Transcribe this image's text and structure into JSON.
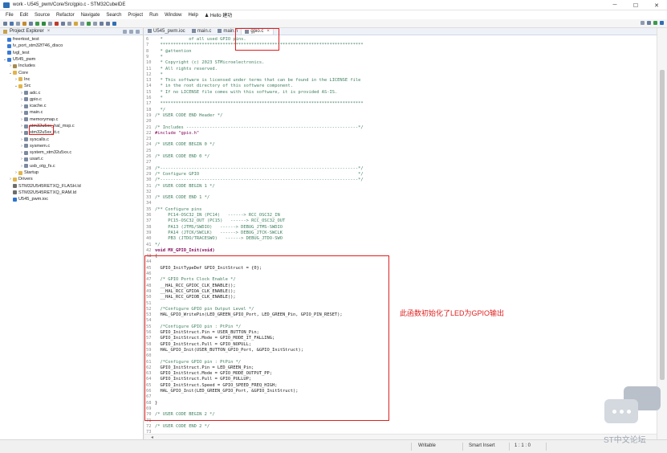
{
  "window": {
    "title": "work - U545_pwm/Core/Src/gpio.c - STM32CubeIDE",
    "minimize": "─",
    "maximize": "☐",
    "close": "✕"
  },
  "menu": [
    "File",
    "Edit",
    "Source",
    "Refactor",
    "Navigate",
    "Search",
    "Project",
    "Run",
    "Window",
    "Help",
    "♟ Hello 建功"
  ],
  "explorer": {
    "tab_label": "Project Explorer",
    "tab_close": "×",
    "tree": [
      {
        "label": "freertost_test",
        "indent": 0,
        "arrow": "",
        "icon": "proj"
      },
      {
        "label": "lv_port_stm32f746_disco",
        "indent": 0,
        "arrow": "",
        "icon": "proj"
      },
      {
        "label": "lvgl_test",
        "indent": 0,
        "arrow": "",
        "icon": "proj"
      },
      {
        "label": "U545_pwm",
        "indent": 0,
        "arrow": "⌄",
        "icon": "proj"
      },
      {
        "label": "Includes",
        "indent": 1,
        "arrow": "›",
        "icon": "inc"
      },
      {
        "label": "Core",
        "indent": 1,
        "arrow": "⌄",
        "icon": "folder"
      },
      {
        "label": "Inc",
        "indent": 2,
        "arrow": "›",
        "icon": "folder"
      },
      {
        "label": "Src",
        "indent": 2,
        "arrow": "⌄",
        "icon": "folder"
      },
      {
        "label": "adc.c",
        "indent": 3,
        "arrow": "›",
        "icon": "c"
      },
      {
        "label": "gpio.c",
        "indent": 3,
        "arrow": "›",
        "icon": "c"
      },
      {
        "label": "icache.c",
        "indent": 3,
        "arrow": "›",
        "icon": "c"
      },
      {
        "label": "main.c",
        "indent": 3,
        "arrow": "›",
        "icon": "c"
      },
      {
        "label": "memorymap.c",
        "indent": 3,
        "arrow": "›",
        "icon": "c"
      },
      {
        "label": "stm32u5xx_hal_msp.c",
        "indent": 3,
        "arrow": "›",
        "icon": "c"
      },
      {
        "label": "stm32u5xx_it.c",
        "indent": 3,
        "arrow": "›",
        "icon": "c"
      },
      {
        "label": "syscalls.c",
        "indent": 3,
        "arrow": "›",
        "icon": "c"
      },
      {
        "label": "sysmem.c",
        "indent": 3,
        "arrow": "›",
        "icon": "c"
      },
      {
        "label": "system_stm32u5xx.c",
        "indent": 3,
        "arrow": "›",
        "icon": "c"
      },
      {
        "label": "usart.c",
        "indent": 3,
        "arrow": "›",
        "icon": "c"
      },
      {
        "label": "usb_otg_fs.c",
        "indent": 3,
        "arrow": "›",
        "icon": "c"
      },
      {
        "label": "Startup",
        "indent": 2,
        "arrow": "›",
        "icon": "folder"
      },
      {
        "label": "Drivers",
        "indent": 1,
        "arrow": "›",
        "icon": "folder"
      },
      {
        "label": "STM32U545RETXQ_FLASH.ld",
        "indent": 1,
        "arrow": "",
        "icon": "ld"
      },
      {
        "label": "STM32U545RETXQ_RAM.ld",
        "indent": 1,
        "arrow": "",
        "icon": "ld"
      },
      {
        "label": "U545_pwm.ioc",
        "indent": 1,
        "arrow": "",
        "icon": "ioc"
      }
    ]
  },
  "editor": {
    "tabs": [
      {
        "label": "U545_pwm.ioc",
        "active": false
      },
      {
        "label": "main.c",
        "active": false
      },
      {
        "label": "main.h",
        "active": false
      },
      {
        "label": "gpio.c",
        "active": true
      }
    ],
    "tab_close": "×",
    "lines": [
      {
        "n": "6",
        "t": "  *          of all used GPIO pins.",
        "k": "cm"
      },
      {
        "n": "7",
        "t": "  ******************************************************************************",
        "k": "cm"
      },
      {
        "n": "8",
        "t": "  * @attention",
        "k": "cm"
      },
      {
        "n": "9",
        "t": "  *",
        "k": "cm"
      },
      {
        "n": "10",
        "t": "  * Copyright (c) 2023 STMicroelectronics.",
        "k": "cm"
      },
      {
        "n": "11",
        "t": "  * All rights reserved.",
        "k": "cm"
      },
      {
        "n": "12",
        "t": "  *",
        "k": "cm"
      },
      {
        "n": "13",
        "t": "  * This software is licensed under terms that can be found in the LICENSE file",
        "k": "cm"
      },
      {
        "n": "14",
        "t": "  * in the root directory of this software component.",
        "k": "cm"
      },
      {
        "n": "15",
        "t": "  * If no LICENSE file comes with this software, it is provided AS-IS.",
        "k": "cm"
      },
      {
        "n": "16",
        "t": "  *",
        "k": "cm"
      },
      {
        "n": "17",
        "t": "  ******************************************************************************",
        "k": "cm"
      },
      {
        "n": "18",
        "t": "  */",
        "k": "cm"
      },
      {
        "n": "19",
        "t": "/* USER CODE END Header */",
        "k": "cm"
      },
      {
        "n": "20",
        "t": "",
        "k": "cm"
      },
      {
        "n": "21",
        "t": "/* Includes ------------------------------------------------------------------*/",
        "k": "cm"
      },
      {
        "n": "22",
        "t": "#include \"gpio.h\"",
        "k": "pp"
      },
      {
        "n": "23",
        "t": "",
        "k": "cm"
      },
      {
        "n": "24",
        "t": "/* USER CODE BEGIN 0 */",
        "k": "cm"
      },
      {
        "n": "25",
        "t": "",
        "k": "cm"
      },
      {
        "n": "26",
        "t": "/* USER CODE END 0 */",
        "k": "cm"
      },
      {
        "n": "27",
        "t": "",
        "k": "cm"
      },
      {
        "n": "28",
        "t": "/*----------------------------------------------------------------------------*/",
        "k": "cm"
      },
      {
        "n": "29",
        "t": "/* Configure GPIO                                                             */",
        "k": "cm"
      },
      {
        "n": "30",
        "t": "/*----------------------------------------------------------------------------*/",
        "k": "cm"
      },
      {
        "n": "31",
        "t": "/* USER CODE BEGIN 1 */",
        "k": "cm"
      },
      {
        "n": "32",
        "t": "",
        "k": "cm"
      },
      {
        "n": "33",
        "t": "/* USER CODE END 1 */",
        "k": "cm"
      },
      {
        "n": "34",
        "t": "",
        "k": "cm"
      },
      {
        "n": "35",
        "t": "/** Configure pins",
        "k": "cm"
      },
      {
        "n": "36",
        "t": "     PC14-OSC32_IN (PC14)   ------> RCC_OSC32_IN",
        "k": "cm"
      },
      {
        "n": "37",
        "t": "     PC15-OSC32_OUT (PC15)   ------> RCC_OSC32_OUT",
        "k": "cm"
      },
      {
        "n": "38",
        "t": "     PA13 (JTMS/SWDIO)   ------> DEBUG_JTMS-SWDIO",
        "k": "cm"
      },
      {
        "n": "39",
        "t": "     PA14 (JTCK/SWCLK)   ------> DEBUG_JTCK-SWCLK",
        "k": "cm"
      },
      {
        "n": "40",
        "t": "     PB3 (JTDO/TRACESWO)   ------> DEBUG_JTDO-SWO",
        "k": "cm"
      },
      {
        "n": "41",
        "t": "*/",
        "k": "cm"
      },
      {
        "n": "42",
        "t": "void MX_GPIO_Init(void)",
        "k": "kw"
      },
      {
        "n": "43",
        "t": "{",
        "k": "code"
      },
      {
        "n": "44",
        "t": "",
        "k": "code"
      },
      {
        "n": "45",
        "t": "  GPIO_InitTypeDef GPIO_InitStruct = {0};",
        "k": "code"
      },
      {
        "n": "46",
        "t": "",
        "k": "code"
      },
      {
        "n": "47",
        "t": "  /* GPIO Ports Clock Enable */",
        "k": "cm"
      },
      {
        "n": "48",
        "t": "  __HAL_RCC_GPIOC_CLK_ENABLE();",
        "k": "code"
      },
      {
        "n": "49",
        "t": "  __HAL_RCC_GPIOA_CLK_ENABLE();",
        "k": "code"
      },
      {
        "n": "50",
        "t": "  __HAL_RCC_GPIOB_CLK_ENABLE();",
        "k": "code"
      },
      {
        "n": "51",
        "t": "",
        "k": "code"
      },
      {
        "n": "52",
        "t": "  /*Configure GPIO pin Output Level */",
        "k": "cm"
      },
      {
        "n": "53",
        "t": "  HAL_GPIO_WritePin(LED_GREEN_GPIO_Port, LED_GREEN_Pin, GPIO_PIN_RESET);",
        "k": "code"
      },
      {
        "n": "54",
        "t": "",
        "k": "code"
      },
      {
        "n": "55",
        "t": "  /*Configure GPIO pin : PtPin */",
        "k": "cm"
      },
      {
        "n": "56",
        "t": "  GPIO_InitStruct.Pin = USER_BUTTON_Pin;",
        "k": "code"
      },
      {
        "n": "57",
        "t": "  GPIO_InitStruct.Mode = GPIO_MODE_IT_FALLING;",
        "k": "code"
      },
      {
        "n": "58",
        "t": "  GPIO_InitStruct.Pull = GPIO_NOPULL;",
        "k": "code"
      },
      {
        "n": "59",
        "t": "  HAL_GPIO_Init(USER_BUTTON_GPIO_Port, &GPIO_InitStruct);",
        "k": "code"
      },
      {
        "n": "60",
        "t": "",
        "k": "code"
      },
      {
        "n": "61",
        "t": "  /*Configure GPIO pin : PtPin */",
        "k": "cm"
      },
      {
        "n": "62",
        "t": "  GPIO_InitStruct.Pin = LED_GREEN_Pin;",
        "k": "code"
      },
      {
        "n": "63",
        "t": "  GPIO_InitStruct.Mode = GPIO_MODE_OUTPUT_PP;",
        "k": "code"
      },
      {
        "n": "64",
        "t": "  GPIO_InitStruct.Pull = GPIO_PULLUP;",
        "k": "code"
      },
      {
        "n": "65",
        "t": "  GPIO_InitStruct.Speed = GPIO_SPEED_FREQ_HIGH;",
        "k": "code"
      },
      {
        "n": "66",
        "t": "  HAL_GPIO_Init(LED_GREEN_GPIO_Port, &GPIO_InitStruct);",
        "k": "code"
      },
      {
        "n": "67",
        "t": "",
        "k": "code"
      },
      {
        "n": "68",
        "t": "}",
        "k": "code"
      },
      {
        "n": "69",
        "t": "",
        "k": "code"
      },
      {
        "n": "70",
        "t": "/* USER CODE BEGIN 2 */",
        "k": "cm"
      },
      {
        "n": "71",
        "t": "",
        "k": "cm"
      },
      {
        "n": "72",
        "t": "/* USER CODE END 2 */",
        "k": "cm"
      },
      {
        "n": "73",
        "t": "",
        "k": "cm"
      }
    ],
    "annotation": "此函数初始化了LED为GPIO输出"
  },
  "status": {
    "writable": "Writable",
    "insert_mode": "Smart Insert",
    "position": "1 : 1 : 0"
  },
  "watermark": {
    "text": "ST中文论坛"
  },
  "colors": {
    "highlight_red": "#e02020",
    "comment_green": "#3f7f5f",
    "keyword_purple": "#7f0055"
  }
}
